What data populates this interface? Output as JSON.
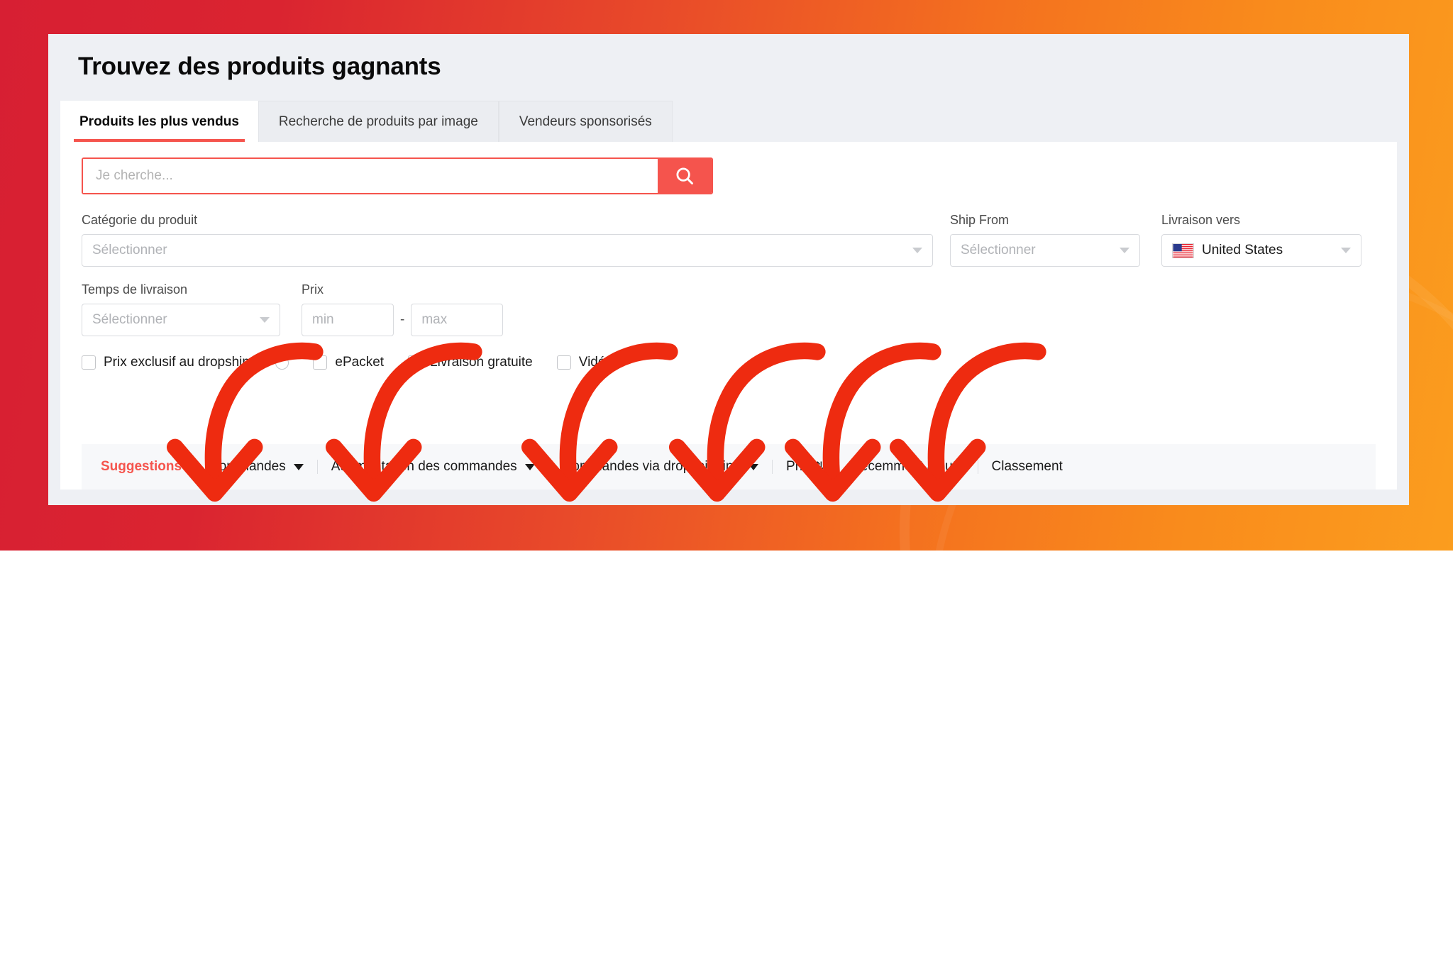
{
  "page": {
    "title": "Trouvez des produits gagnants"
  },
  "theme": {
    "accent": "#f5544d",
    "arrow_color": "#ee2b10",
    "bg_gradient_start": "#d71f33",
    "bg_gradient_end": "#fb9d1e",
    "card_bg": "#eef0f4",
    "panel_bg": "#ffffff",
    "sortbar_bg": "#f7f8fa"
  },
  "tabs": [
    {
      "label": "Produits les plus vendus",
      "active": true
    },
    {
      "label": "Recherche de produits par image",
      "active": false
    },
    {
      "label": "Vendeurs sponsorisés",
      "active": false
    }
  ],
  "search": {
    "placeholder": "Je cherche...",
    "value": "",
    "button_icon": "search-icon"
  },
  "filters": {
    "category": {
      "label": "Catégorie du produit",
      "value": "Sélectionner"
    },
    "ship_from": {
      "label": "Ship From",
      "value": "Sélectionner"
    },
    "ship_to": {
      "label": "Livraison vers",
      "value": "United States",
      "flag": "us-flag-icon"
    },
    "delivery_time": {
      "label": "Temps de livraison",
      "value": "Sélectionner"
    },
    "price": {
      "label": "Prix",
      "min_placeholder": "min",
      "min_value": "",
      "max_placeholder": "max",
      "max_value": "",
      "separator": "-"
    }
  },
  "checkboxes": [
    {
      "label": "Prix exclusif au dropshipper",
      "checked": false,
      "info": true
    },
    {
      "label": "ePacket",
      "checked": false,
      "info": false
    },
    {
      "label": "Livraison gratuite",
      "checked": false,
      "info": false
    },
    {
      "label": "Vidéo",
      "checked": false,
      "info": false
    }
  ],
  "sort_bar": [
    {
      "label": "Suggestions",
      "active": true,
      "caret": false,
      "updown": false
    },
    {
      "label": "Commandes",
      "active": false,
      "caret": true,
      "updown": false
    },
    {
      "label": "Augmentation des commandes",
      "active": false,
      "caret": true,
      "updown": false
    },
    {
      "label": "Commandes via dropshipping",
      "active": false,
      "caret": true,
      "updown": false
    },
    {
      "label": "Prix",
      "active": false,
      "caret": false,
      "updown": true,
      "updown_glyph": "⇅"
    },
    {
      "label": "Récemment ajouté",
      "active": false,
      "caret": false,
      "updown": false
    },
    {
      "label": "Classement",
      "active": false,
      "caret": false,
      "updown": false
    }
  ],
  "annotations": {
    "type": "hand-drawn-arrows",
    "color": "#ee2b10",
    "count": 6,
    "description": "Six curved red arrows pointing down at the sort bar options"
  }
}
